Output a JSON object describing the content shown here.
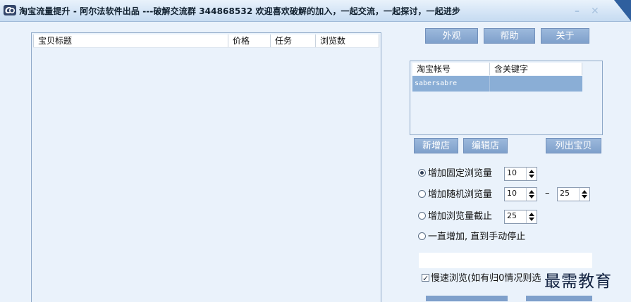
{
  "window": {
    "title": "淘宝流量提升 - 阿尔法软件出品 ---破解交流群 344868532 欢迎喜欢破解的加入，一起交流，一起探讨，一起进步",
    "minimize_glyph": "–",
    "close_glyph": "✕"
  },
  "product_list": {
    "columns": [
      "宝贝标题",
      "价格",
      "任务",
      "浏览数"
    ]
  },
  "top_buttons": {
    "appearance": "外观",
    "help": "帮助",
    "about": "关于"
  },
  "accounts": {
    "columns": [
      "淘宝帐号",
      "含关键字"
    ],
    "rows": [
      {
        "account": "sabersabre",
        "keyword": ""
      }
    ]
  },
  "shop_buttons": {
    "add_shop": "新增店",
    "edit_shop": "编辑店",
    "list_items": "列出宝贝"
  },
  "options": {
    "fixed": {
      "label": "增加固定浏览量",
      "selected": true,
      "value": "10"
    },
    "random": {
      "label": "增加随机浏览量",
      "selected": false,
      "min": "10",
      "separator": "–",
      "max": "25"
    },
    "cutoff": {
      "label": "增加浏览量截止",
      "selected": false,
      "value": "25"
    },
    "continuous": {
      "label": "一直增加, 直到手动停止",
      "selected": false
    }
  },
  "slow_browse": {
    "checked": true,
    "label": "慢速浏览(如有归0情况则选"
  },
  "watermark": "最需教育",
  "colors": {
    "button": "#8fadd4",
    "selected_row": "#8aaed6",
    "background": "#eaf2fb"
  }
}
